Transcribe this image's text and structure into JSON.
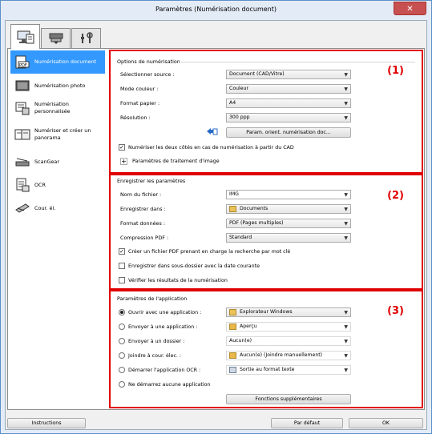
{
  "window": {
    "title": "Paramètres (Numérisation document)",
    "close_glyph": "✕"
  },
  "tabs": [
    {
      "icon": "scan-from-computer-icon"
    },
    {
      "icon": "scan-from-operation-panel-icon"
    },
    {
      "icon": "general-settings-icon"
    }
  ],
  "sidebar": {
    "items": [
      {
        "label": "Numérisation document",
        "icon": "document-scan-icon",
        "active": true
      },
      {
        "label": "Numérisation photo",
        "icon": "photo-scan-icon"
      },
      {
        "label": "Numérisation personnalisée",
        "icon": "custom-scan-icon"
      },
      {
        "label": "Numériser et créer un panorama",
        "icon": "panorama-scan-icon"
      },
      {
        "label": "ScanGear",
        "icon": "scangear-icon"
      },
      {
        "label": "OCR",
        "icon": "ocr-icon"
      },
      {
        "label": "Cour. él.",
        "icon": "email-icon"
      }
    ]
  },
  "scan_options": {
    "title": "Options de numérisation",
    "number": "(1)",
    "source_label": "Sélectionner source :",
    "source_value": "Document (CAD/Vitre)",
    "color_label": "Mode couleur :",
    "color_value": "Couleur",
    "paper_label": "Format papier :",
    "paper_value": "A4",
    "resolution_label": "Résolution :",
    "resolution_value": "300 ppp",
    "orientation_button": "Param. orient. numérisation doc...",
    "duplex_label": "Numériser les deux côtés en cas de numérisation à partir du CAD",
    "duplex_checked": true,
    "image_processing_label": "Paramètres de traitement d'image"
  },
  "save_settings": {
    "title": "Enregistrer les paramètres",
    "number": "(2)",
    "filename_label": "Nom du fichier :",
    "filename_value": "IMG",
    "save_in_label": "Enregistrer dans :",
    "save_in_value": "Documents",
    "format_label": "Format données :",
    "format_value": "PDF (Pages multiples)",
    "compression_label": "Compression PDF :",
    "compression_value": "Standard",
    "searchable_pdf_label": "Créer un fichier PDF prenant en charge la recherche par mot clé",
    "searchable_pdf_checked": true,
    "subfolder_label": "Enregistrer dans sous-dossier avec la date courante",
    "subfolder_checked": false,
    "verify_label": "Vérifier les résultats de la numérisation",
    "verify_checked": false
  },
  "app_settings": {
    "title": "Paramètres de l'application",
    "number": "(3)",
    "options": [
      {
        "label": "Ouvrir avec une application :",
        "value": "Explorateur Windows",
        "selected": true
      },
      {
        "label": "Envoyer à une application :",
        "value": "Aperçu"
      },
      {
        "label": "Envoyer à un dossier :",
        "value": "Aucun(e)"
      },
      {
        "label": "Joindre à cour. élec. :",
        "value": "Aucun(e) (Joindre manuellement)"
      },
      {
        "label": "Démarrer l'application OCR :",
        "value": "Sortie au format texte"
      },
      {
        "label": "Ne démarrez aucune application"
      }
    ],
    "more_button": "Fonctions supplémentaires"
  },
  "footer": {
    "instructions": "Instructions",
    "defaults": "Par défaut",
    "ok": "OK"
  },
  "colors": {
    "accent": "#3399ff",
    "highlight_border": "#e00000",
    "title_bar": "#dce8f5"
  }
}
